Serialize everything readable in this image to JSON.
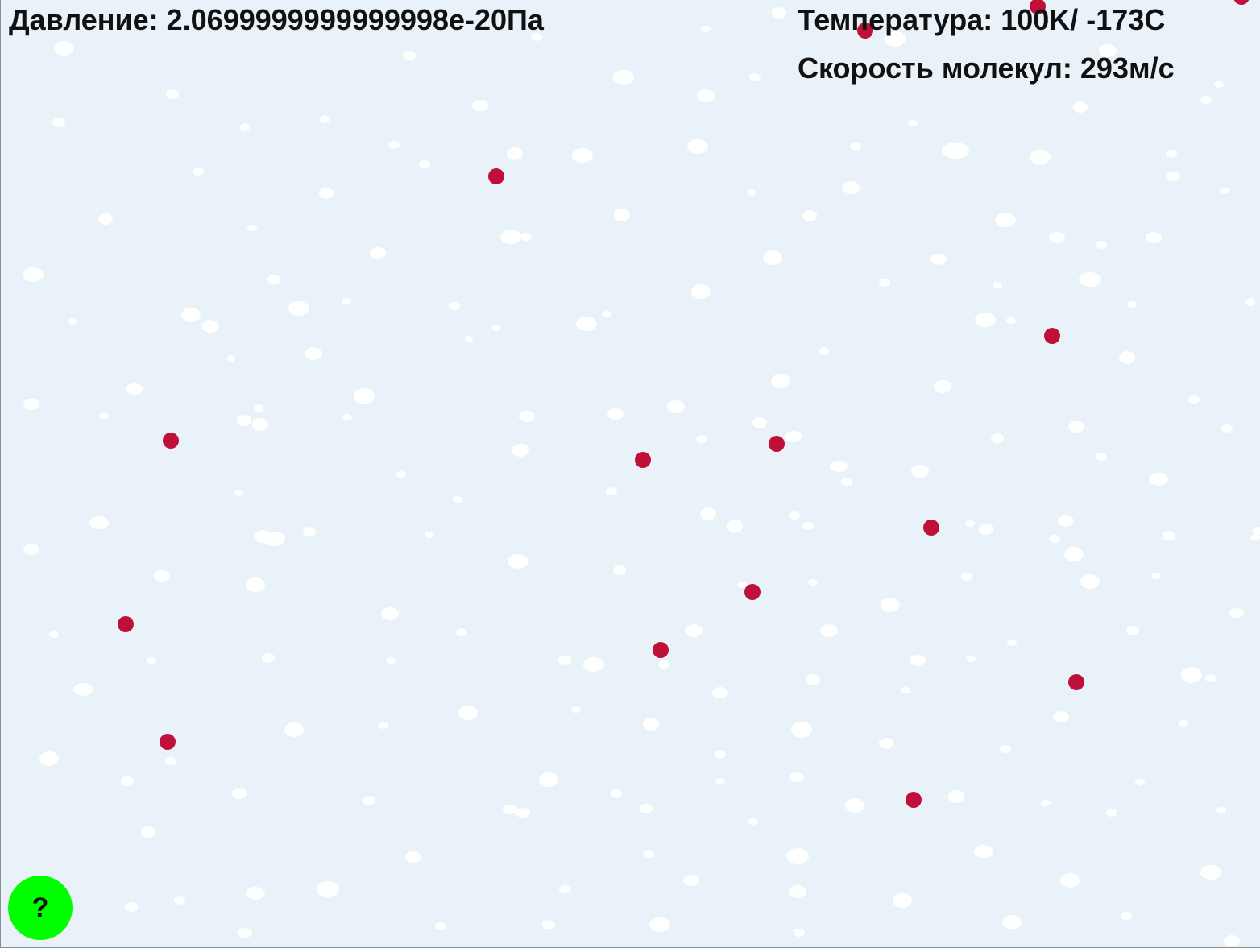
{
  "hud": {
    "pressure": "Давление: 2.0699999999999998e-20Па",
    "temperature": "Температура: 100K/ -173C",
    "speed": "Скорость молекул: 293м/с"
  },
  "help": {
    "label": "?"
  },
  "colors": {
    "background": "#e8f2f8",
    "molecule": "#c0103a",
    "snow": "#ffffff",
    "help_button": "#00ff00"
  },
  "simulation": {
    "molecule_count": 16
  }
}
